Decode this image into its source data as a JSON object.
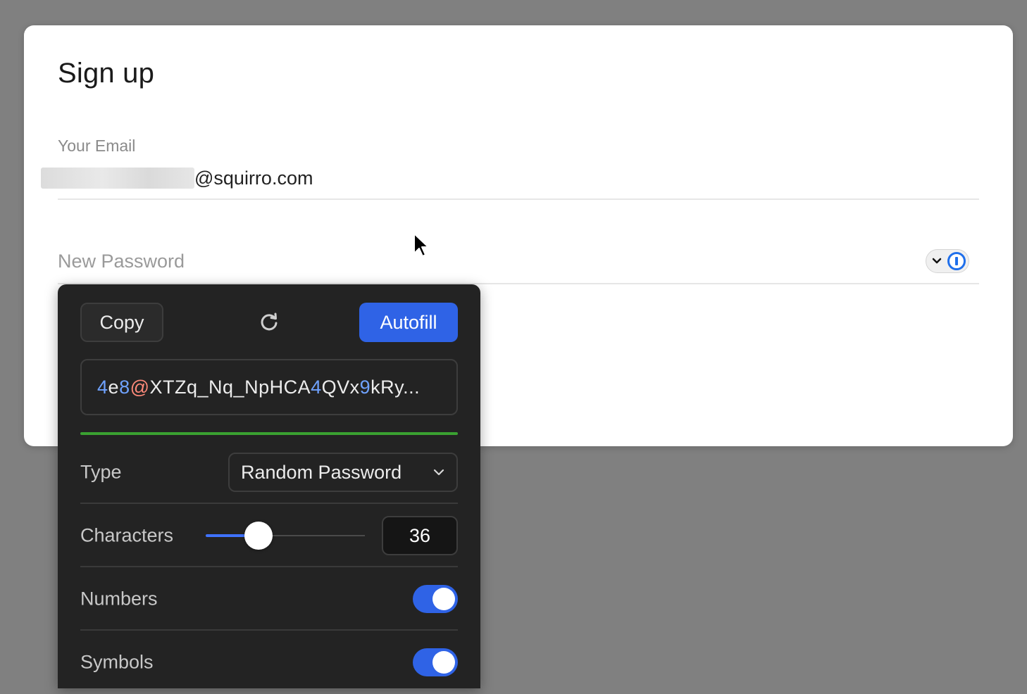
{
  "form": {
    "title": "Sign up",
    "email_label": "Your Email",
    "email_value_visible": "@squirro.com",
    "password_label": "New Password"
  },
  "password_manager_button": {
    "icon": "onepassword-icon",
    "chevron_icon": "chevron-down-icon"
  },
  "generator": {
    "copy_label": "Copy",
    "refresh_icon": "refresh-icon",
    "autofill_label": "Autofill",
    "password_segments": [
      {
        "text": "4",
        "kind": "digit"
      },
      {
        "text": "e",
        "kind": "letter"
      },
      {
        "text": "8",
        "kind": "digit"
      },
      {
        "text": "@",
        "kind": "symbol"
      },
      {
        "text": "XTZq_Nq_NpHCA",
        "kind": "letter"
      },
      {
        "text": "4",
        "kind": "digit"
      },
      {
        "text": "QVx",
        "kind": "letter"
      },
      {
        "text": "9",
        "kind": "digit"
      },
      {
        "text": "kRy...",
        "kind": "letter"
      }
    ],
    "strength_color": "#3aa131",
    "type_label": "Type",
    "type_value": "Random Password",
    "characters_label": "Characters",
    "characters_value": "36",
    "characters_slider_fraction": 0.33,
    "numbers_label": "Numbers",
    "numbers_enabled": true,
    "symbols_label": "Symbols",
    "symbols_enabled": true
  },
  "colors": {
    "accent": "#2f63e6",
    "digit": "#6fa2ff",
    "symbol": "#ff8a7a"
  }
}
